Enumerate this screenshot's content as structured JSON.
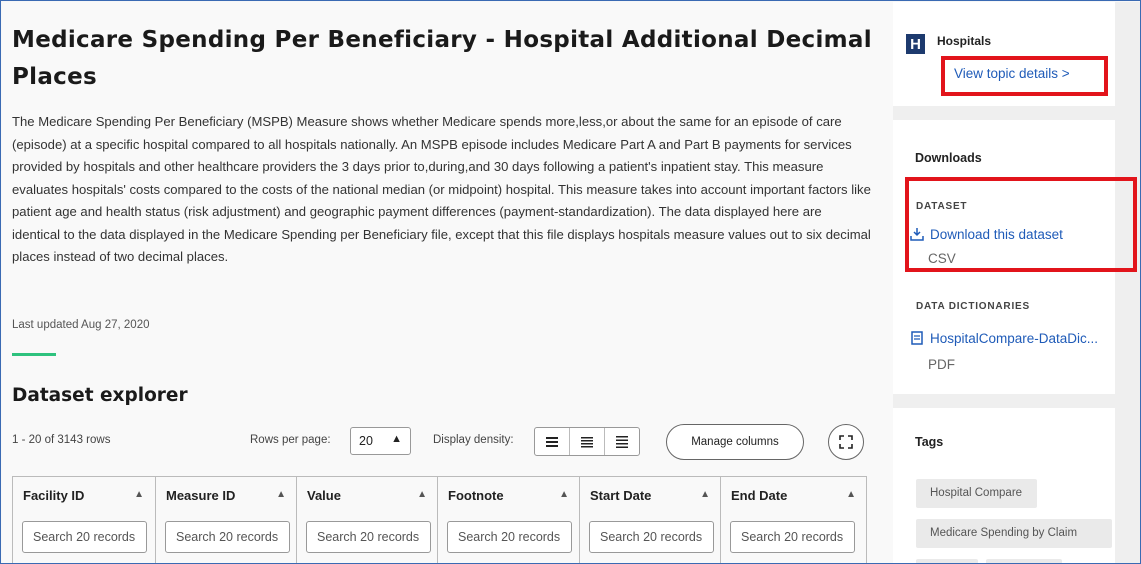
{
  "page": {
    "title": "Medicare Spending Per Beneficiary - Hospital Additional Decimal Places",
    "description": "The Medicare Spending Per Beneficiary (MSPB) Measure shows whether Medicare spends more,less,or about the same for an episode of care (episode) at a specific hospital compared to all hospitals nationally. An MSPB episode includes Medicare Part A and Part B payments for services provided by hospitals and other healthcare providers the 3 days prior to,during,and 30 days following a patient's inpatient stay. This measure evaluates hospitals' costs compared to the costs of the national median (or midpoint) hospital. This measure takes into account important factors like patient age and health status (risk adjustment) and geographic payment differences (payment-standardization). The data displayed here are identical to the data displayed in the Medicare Spending per Beneficiary file, except that this file displays hospitals measure values out to six decimal places instead of two decimal places.",
    "last_updated": "Last updated Aug 27, 2020"
  },
  "explorer": {
    "title": "Dataset explorer",
    "row_count": "1 - 20  of 3143 rows",
    "rows_per_page_label": "Rows per page:",
    "rows_per_page_value": "20",
    "density_label": "Display density:",
    "manage_columns": "Manage columns",
    "columns": [
      {
        "label": "Facility ID",
        "placeholder": "Search 20 records"
      },
      {
        "label": "Measure ID",
        "placeholder": "Search 20 records"
      },
      {
        "label": "Value",
        "placeholder": "Search 20 records"
      },
      {
        "label": "Footnote",
        "placeholder": "Search 20 records"
      },
      {
        "label": "Start Date",
        "placeholder": "Search 20 records"
      },
      {
        "label": "End Date",
        "placeholder": "Search 20 records"
      }
    ]
  },
  "sidebar": {
    "topic": {
      "logo": "H",
      "name": "Hospitals",
      "link": "View topic details >"
    },
    "downloads": {
      "heading": "Downloads",
      "dataset_label": "DATASET",
      "dataset_link": "Download this dataset",
      "dataset_format": "CSV",
      "dict_label": "DATA DICTIONARIES",
      "dict_link": "HospitalCompare-DataDic...",
      "dict_format": "PDF"
    },
    "tags": {
      "heading": "Tags",
      "items": [
        "Hospital Compare",
        "Medicare Spending by Claim"
      ]
    }
  },
  "colors": {
    "link": "#1f5bb8",
    "highlight": "#e2141b",
    "accent": "#2ec27e",
    "logo": "#1d3a6e"
  }
}
